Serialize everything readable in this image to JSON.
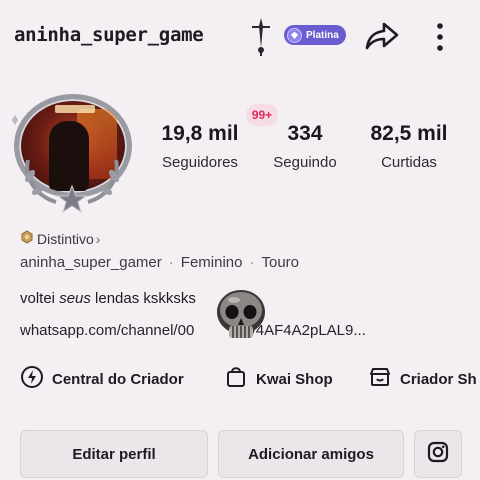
{
  "header": {
    "username_title": "aninha_super_game",
    "tier_badge": "Platina",
    "icons": [
      "sword-icon",
      "gem-icon",
      "share-icon",
      "more-icon"
    ],
    "tier_color": "#6b5ccf"
  },
  "stats": {
    "new_count": "99+",
    "followers": {
      "value": "19,8 mil",
      "label": "Seguidores"
    },
    "following": {
      "value": "334",
      "label": "Seguindo"
    },
    "likes": {
      "value": "82,5 mil",
      "label": "Curtidas"
    }
  },
  "profile": {
    "badge_link": "Distintivo",
    "username": "aninha_super_gamer",
    "gender": "Feminino",
    "zodiac": "Touro",
    "bio": {
      "part1": "voltei ",
      "part2": "seus",
      "part3": " lendas kskksks"
    },
    "link": "whatsapp.com/channel/00",
    "link_tail": "v4AF4A2pLAL9..."
  },
  "shortcuts": {
    "creator_center": "Central do Criador",
    "kwai_shop": "Kwai Shop",
    "creator_shop": "Criador Sh"
  },
  "actions": {
    "edit_profile": "Editar perfil",
    "add_friends": "Adicionar amigos",
    "instagram_icon": "instagram-icon"
  },
  "colors": {
    "accent_red": "#e02a5c",
    "background": "#f3eff2"
  }
}
